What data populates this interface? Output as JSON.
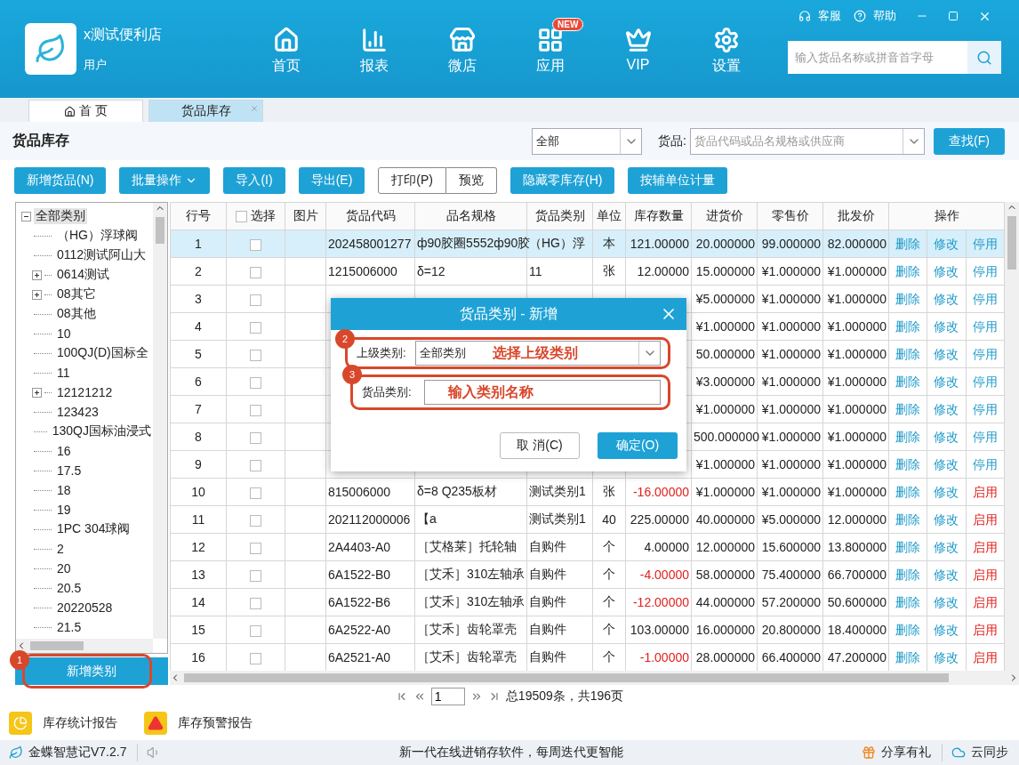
{
  "app": {
    "store_name": "x测试便利店",
    "user": "用户",
    "top_links": [
      "客服",
      "帮助"
    ],
    "nav": [
      {
        "label": "首页"
      },
      {
        "label": "报表"
      },
      {
        "label": "微店"
      },
      {
        "label": "应用",
        "badge": "NEW"
      },
      {
        "label": "VIP"
      },
      {
        "label": "设置"
      }
    ],
    "search": {
      "placeholder": "输入货品名称或拼音首字母"
    }
  },
  "tabs": [
    {
      "label": "首 页",
      "selected": false,
      "home": true
    },
    {
      "label": "货品库存",
      "selected": true,
      "closable": true
    }
  ],
  "page": {
    "title": "货品库存",
    "filter_select": "全部",
    "goods_label": "货品:",
    "goods_placeholder": "货品代码或品名规格或供应商",
    "find_button": "查找(F)"
  },
  "toolbar": [
    {
      "label": "新增货品(N)",
      "kind": "button"
    },
    {
      "label": "批量操作",
      "kind": "dropdown"
    },
    {
      "label": "导入(I)",
      "kind": "button"
    },
    {
      "label": "导出(E)",
      "kind": "button"
    },
    {
      "label": "打印(P)",
      "kind": "outline"
    },
    {
      "label": "预览",
      "kind": "outline"
    },
    {
      "label": "隐藏零库存(H)",
      "kind": "button"
    },
    {
      "label": "按辅单位计量",
      "kind": "button"
    }
  ],
  "tree": [
    {
      "label": "全部类别",
      "expanded": true,
      "selected": true,
      "children": [
        {
          "label": "（HG）浮球阀"
        },
        {
          "label": "0112测试阿山大"
        },
        {
          "label": "0614测试",
          "expanded": false
        },
        {
          "label": "08其它",
          "expanded": false
        },
        {
          "label": "08其他"
        },
        {
          "label": "10"
        },
        {
          "label": "100QJ(D)国标全"
        },
        {
          "label": "11"
        },
        {
          "label": "12121212",
          "expanded": false
        },
        {
          "label": "123423"
        },
        {
          "label": "130QJ国标油浸式"
        },
        {
          "label": "16"
        },
        {
          "label": "17.5"
        },
        {
          "label": "18"
        },
        {
          "label": "19"
        },
        {
          "label": "1PC 304球阀"
        },
        {
          "label": "2"
        },
        {
          "label": "20"
        },
        {
          "label": "20.5"
        },
        {
          "label": "20220528"
        },
        {
          "label": "21.5"
        }
      ]
    }
  ],
  "add_category_button": {
    "label": "新增类别",
    "annotation": "1"
  },
  "table": {
    "columns": [
      "行号",
      "选择",
      "图片",
      "货品代码",
      "品名规格",
      "货品类别",
      "单位",
      "库存数量",
      "进货价",
      "零售价",
      "批发价",
      "操作"
    ],
    "select_all_checked": false,
    "rows": [
      {
        "no": "1",
        "checked": false,
        "selected": true,
        "code": "202458001277",
        "name": "ф90胶圈5552ф90胶",
        "category": "（HG）浮",
        "unit": "本",
        "qty": "121.00000",
        "qty_alert": false,
        "cost": "20.000000",
        "retail": "99.000000",
        "wholesale": "82.000000",
        "actions": [
          "删除",
          "修改",
          "停用"
        ],
        "disabled": false
      },
      {
        "no": "2",
        "checked": false,
        "selected": false,
        "code": "1215006000",
        "name": "δ=12",
        "category": "11",
        "unit": "张",
        "qty": "12.00000",
        "qty_alert": false,
        "cost": "15.000000",
        "retail": "¥1.000000",
        "wholesale": "¥1.000000",
        "actions": [
          "删除",
          "修改",
          "停用"
        ],
        "disabled": false
      },
      {
        "no": "3",
        "checked": false,
        "selected": false,
        "cost": "¥5.000000",
        "retail": "¥1.000000",
        "wholesale": "¥1.000000",
        "actions": [
          "删除",
          "修改",
          "停用"
        ],
        "disabled": false
      },
      {
        "no": "4",
        "checked": false,
        "selected": false,
        "cost": "¥1.000000",
        "retail": "¥1.000000",
        "wholesale": "¥1.000000",
        "actions": [
          "删除",
          "修改",
          "停用"
        ],
        "disabled": false
      },
      {
        "no": "5",
        "checked": false,
        "selected": false,
        "cost": "50.000000",
        "retail": "¥1.000000",
        "wholesale": "¥1.000000",
        "actions": [
          "删除",
          "修改",
          "停用"
        ],
        "disabled": false
      },
      {
        "no": "6",
        "checked": false,
        "selected": false,
        "cost": "¥3.000000",
        "retail": "¥1.000000",
        "wholesale": "¥1.000000",
        "actions": [
          "删除",
          "修改",
          "停用"
        ],
        "disabled": false
      },
      {
        "no": "7",
        "checked": false,
        "selected": false,
        "cost": "¥1.000000",
        "retail": "¥1.000000",
        "wholesale": "¥1.000000",
        "actions": [
          "删除",
          "修改",
          "停用"
        ],
        "disabled": false
      },
      {
        "no": "8",
        "checked": false,
        "selected": false,
        "cost": "500.000000",
        "retail": "¥1.000000",
        "wholesale": "¥1.000000",
        "actions": [
          "删除",
          "修改",
          "停用"
        ],
        "disabled": false
      },
      {
        "no": "9",
        "checked": false,
        "selected": false,
        "cost": "¥1.000000",
        "retail": "¥1.000000",
        "wholesale": "¥1.000000",
        "actions": [
          "删除",
          "修改",
          "停用"
        ],
        "disabled": false
      },
      {
        "no": "10",
        "checked": false,
        "selected": false,
        "code": "815006000",
        "name": "δ=8 Q235板材",
        "category": "测试类别1",
        "unit": "张",
        "qty": "-16.00000",
        "qty_alert": true,
        "cost": "¥1.000000",
        "retail": "¥1.000000",
        "wholesale": "¥1.000000",
        "actions": [
          "删除",
          "修改",
          "启用"
        ],
        "disabled": true
      },
      {
        "no": "11",
        "checked": false,
        "selected": false,
        "code": "202112000006",
        "name": "【a",
        "category": "测试类别1",
        "unit": "40",
        "qty": "225.00000",
        "qty_alert": false,
        "cost": "40.000000",
        "retail": "¥5.000000",
        "wholesale": "12.000000",
        "actions": [
          "删除",
          "修改",
          "启用"
        ],
        "disabled": true
      },
      {
        "no": "12",
        "checked": false,
        "selected": false,
        "code": "2A4403-A0",
        "name": "［艾格莱］托轮轴",
        "category": "自购件",
        "unit": "个",
        "qty": "4.00000",
        "qty_alert": false,
        "cost": "12.000000",
        "retail": "15.600000",
        "wholesale": "13.800000",
        "actions": [
          "删除",
          "修改",
          "启用"
        ],
        "disabled": true
      },
      {
        "no": "13",
        "checked": false,
        "selected": false,
        "code": "6A1522-B0",
        "name": "［艾禾］310左轴承",
        "category": "自购件",
        "unit": "个",
        "qty": "-4.00000",
        "qty_alert": true,
        "cost": "58.000000",
        "retail": "75.400000",
        "wholesale": "66.700000",
        "actions": [
          "删除",
          "修改",
          "启用"
        ],
        "disabled": true
      },
      {
        "no": "14",
        "checked": false,
        "selected": false,
        "code": "6A1522-B6",
        "name": "［艾禾］310左轴承",
        "category": "自购件",
        "unit": "个",
        "qty": "-12.00000",
        "qty_alert": true,
        "cost": "44.000000",
        "retail": "57.200000",
        "wholesale": "50.600000",
        "actions": [
          "删除",
          "修改",
          "启用"
        ],
        "disabled": true
      },
      {
        "no": "15",
        "checked": false,
        "selected": false,
        "code": "6A2522-A0",
        "name": "［艾禾］齿轮罩壳",
        "category": "自购件",
        "unit": "个",
        "qty": "103.00000",
        "qty_alert": false,
        "cost": "16.000000",
        "retail": "20.800000",
        "wholesale": "18.400000",
        "actions": [
          "删除",
          "修改",
          "启用"
        ],
        "disabled": true
      },
      {
        "no": "16",
        "checked": false,
        "selected": false,
        "code": "6A2521-A0",
        "name": "［艾禾］齿轮罩壳",
        "category": "自购件",
        "unit": "个",
        "qty": "-1.00000",
        "qty_alert": true,
        "cost": "28.000000",
        "retail": "66.400000",
        "wholesale": "47.200000",
        "actions": [
          "删除",
          "修改",
          "启用"
        ],
        "disabled": true
      }
    ]
  },
  "dialog": {
    "title": "货品类别 - 新增",
    "parent_label": "上级类别:",
    "parent_value": "全部类别",
    "parent_annotation": "2",
    "parent_hint": "选择上级类别",
    "name_label": "货品类别:",
    "name_annotation": "3",
    "name_hint": "输入类别名称",
    "cancel": "取 消(C)",
    "ok": "确定(O)"
  },
  "pager": {
    "page": "1",
    "summary": "总19509条，共196页"
  },
  "reports": [
    {
      "label": "库存统计报告"
    },
    {
      "label": "库存预警报告"
    }
  ],
  "status_bar": {
    "version": "金蝶智慧记V7.2.7",
    "slogan": "新一代在线进销存软件，每周迭代更智能",
    "share": "分享有礼",
    "sync": "云同步"
  }
}
